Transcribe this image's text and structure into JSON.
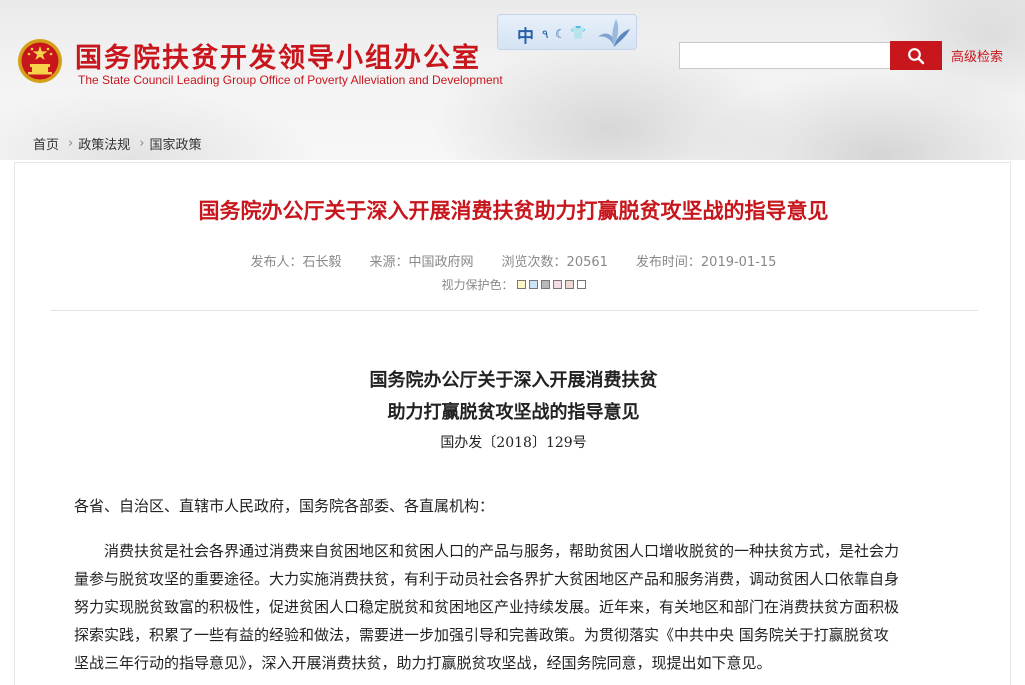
{
  "header": {
    "title_cn": "国务院扶贫开发领导小组办公室",
    "title_en": "The State Council Leading Group Office of Poverty Alleviation and Development",
    "lang_badge": "中",
    "search_placeholder": "",
    "advanced_search": "高级检索"
  },
  "breadcrumb": [
    "首页",
    "政策法规",
    "国家政策"
  ],
  "article": {
    "title": "国务院办公厅关于深入开展消费扶贫助力打赢脱贫攻坚战的指导意见",
    "publisher": "发布人：石长毅",
    "source": "来源：中国政府网",
    "views": "浏览次数：20561",
    "date": "发布时间：2019-01-15",
    "eye_care_label": "视力保护色：",
    "eye_care_colors": [
      "#fdf7c8",
      "#cfe4f2",
      "#b9b9b9",
      "#f5dde4",
      "#ecd7d1",
      "#ffffff"
    ]
  },
  "document": {
    "title_line1": "国务院办公厅关于深入开展消费扶贫",
    "title_line2": "助力打赢脱贫攻坚战的指导意见",
    "number": "国办发〔2018〕129号",
    "salutation": "各省、自治区、直辖市人民政府，国务院各部委、各直属机构：",
    "paragraph_lines": [
      "　　消费扶贫是社会各界通过消费来自贫困地区和贫困人口的产品与服务，帮助贫困人口增收脱贫的一种扶贫方式，是社会力",
      "量参与脱贫攻坚的重要途径。大力实施消费扶贫，有利于动员社会各界扩大贫困地区产品和服务消费，调动贫困人口依靠自身",
      "努力实现脱贫致富的积极性，促进贫困人口稳定脱贫和贫困地区产业持续发展。近年来，有关地区和部门在消费扶贫方面积极",
      "探索实践，积累了一些有益的经验和做法，需要进一步加强引导和完善政策。为贯彻落实《中共中央 国务院关于打赢脱贫攻",
      "坚战三年行动的指导意见》，深入开展消费扶贫，助力打赢脱贫攻坚战，经国务院同意，现提出如下意见。"
    ]
  }
}
